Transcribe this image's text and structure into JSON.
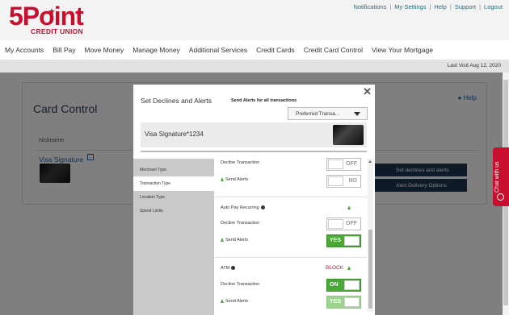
{
  "brand": {
    "logo_main": "5Point",
    "logo_sub": "CREDIT UNION"
  },
  "utility_nav": [
    "Notifications",
    "My Settings",
    "Help",
    "Support",
    "Logout"
  ],
  "main_nav": [
    "My Accounts",
    "Bill Pay",
    "Move Money",
    "Manage Money",
    "Additional Services",
    "Credit Cards",
    "Credit Card Control",
    "View Your Mortgage"
  ],
  "last_visit": "Last Visit Aug 12, 2020",
  "page": {
    "title": "Card Control",
    "help": "Help",
    "nickname_label": "Nickname",
    "card_name": "Visa Signature",
    "btn_declines": "Set declines and alerts",
    "btn_delivery": "Alert Delivery Options"
  },
  "chat": "Chat with us",
  "modal": {
    "title": "Set Declines and Alerts",
    "send_all": "Send Alerts for all transactions",
    "select_value": "Preferred Transa...",
    "account_name": "Visa Signature",
    "account_suffix": "*1234",
    "side_items": [
      "Merchant Type",
      "Transaction Type",
      "Location Type",
      "Spend Limits"
    ],
    "active_side_item": "Transaction Type",
    "sections": [
      {
        "title": "",
        "rows": [
          {
            "label": "Decline Transaction",
            "toggle": "OFF",
            "state": "off"
          },
          {
            "label": "Send Alerts",
            "toggle": "NO",
            "state": "off"
          }
        ]
      },
      {
        "title": "Auto Pay Recurring",
        "rows": [
          {
            "label": "Decline Transaction",
            "toggle": "OFF",
            "state": "off"
          },
          {
            "label": "Send Alerts",
            "toggle": "YES",
            "state": "on"
          }
        ]
      },
      {
        "title": "ATM",
        "status": "BLOCK",
        "rows": [
          {
            "label": "Decline Transaction",
            "toggle": "ON",
            "state": "on"
          },
          {
            "label": "Send Alerts",
            "toggle": "YES",
            "state": "faded"
          }
        ]
      }
    ]
  },
  "colors": {
    "brand_red": "#c8102e",
    "toggle_green": "#4aa834",
    "nav_dark": "#1c3550"
  }
}
